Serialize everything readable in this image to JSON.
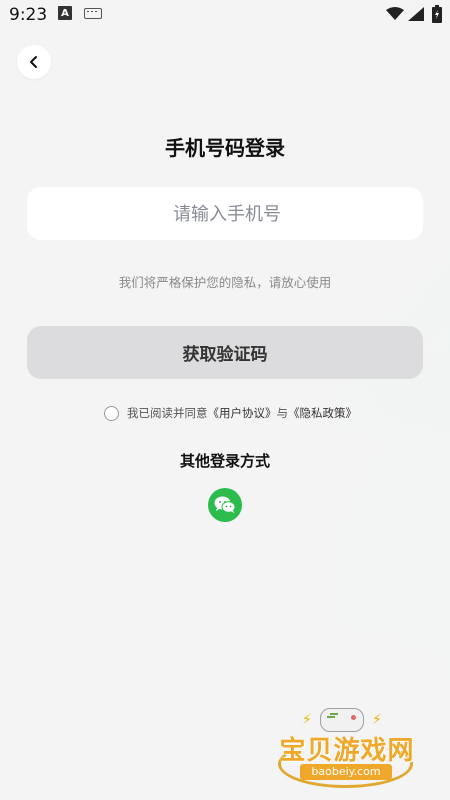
{
  "status_bar": {
    "time": "9:23",
    "a_badge": "A",
    "icons": [
      "keyboard-icon",
      "wifi-icon",
      "signal-icon",
      "battery-icon"
    ]
  },
  "header": {
    "back_icon": "back-arrow-icon",
    "title": "手机号码登录"
  },
  "phone_input": {
    "placeholder": "请输入手机号",
    "value": ""
  },
  "privacy_tip": "我们将严格保护您的隐私，请放心使用",
  "get_code_button": "获取验证码",
  "agreement": {
    "prefix": "我已阅读并同意",
    "user_agreement": "《用户协议》",
    "and": "与",
    "privacy_policy": "《隐私政策》",
    "checked": false
  },
  "other_login": {
    "title": "其他登录方式",
    "wechat_icon": "wechat-icon"
  },
  "watermark": {
    "text": "宝贝游戏网",
    "url": "baobeiy.com"
  },
  "colors": {
    "wechat_green": "#2cbc4e",
    "button_gray": "#dcdcde",
    "watermark_orange": "#f0a82a"
  }
}
